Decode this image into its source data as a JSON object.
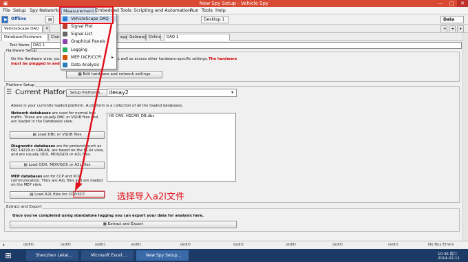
{
  "window": {
    "title": "New Spy Setup - Vehicle Spy"
  },
  "menu": [
    "File",
    "Setup",
    "Spy Networks",
    "Measurement",
    "Embedded Tools",
    "Scripting and Automation",
    "Run",
    "Tools",
    "Help"
  ],
  "toolbar": {
    "mode": "Offline",
    "desktop": "Desktop 1",
    "data": "Data"
  },
  "tabs_row1": [
    "VehicleScape DAQ"
  ],
  "tabs_row2": [
    "Database/Hardware Setup",
    "Chann",
    "ogging",
    "Gateway",
    "Online",
    "DAQ 1"
  ],
  "test_name": {
    "label": "Test Name",
    "value": "DAQ 1"
  },
  "hardware_setup": {
    "label": "Hardware Setup",
    "text_prefix": "On the Hardware view, you",
    "text_suffix": "s well as access other hardware-specific settings.",
    "warning1": "The hardware",
    "warning2": "must be plugged in and p",
    "edit_button": "Edit hardware and network settings"
  },
  "platform_setup": {
    "label": "Platform Setup",
    "title": "Current Platform",
    "setup_button": "Setup Platforms...",
    "platform_value": "desay2",
    "desc": "Above is your currently loaded platform. A platform is a collection of all the loaded databases."
  },
  "network_db": {
    "title": "Network databases",
    "text": " are used for normal bus traffic. These are usually DBC or VSDB files and are loaded in the Databases view.",
    "button": "Load DBC or VSDB files",
    "list": [
      "HS CAN: HSCAN_DB.dbc"
    ]
  },
  "diagnostic_db": {
    "title": "Diagnostic databases",
    "text": " are for protocols such as ISO 14229 or GMLAN, are based on the ECUs view, and are usually ODX, MDX/GDX or A2L files.",
    "button": "Load ODX, MDX/GDX or A2L files"
  },
  "mep_db": {
    "title": "MEP databases",
    "text": " are for CCP and XCP communication. They are A2L files and are loaded on the MEP view.",
    "button": "Load A2L files for CCP/XCP"
  },
  "annotation": "选择导入a2l文件",
  "extract": {
    "label": "Extract and Export",
    "text": "Once you've completed using standalone logging you can export your data for analysis here.",
    "button": "Extract and Export"
  },
  "dropdown": [
    {
      "label": "VehicleScape DAQ",
      "icon": "daq-icon",
      "color": "#2c7fd6"
    },
    {
      "label": "Signal Plot",
      "icon": "plot-icon",
      "color": "#c0392b"
    },
    {
      "label": "Signal List",
      "icon": "list-icon",
      "color": "#666666"
    },
    {
      "label": "Graphical Panels",
      "icon": "panel-icon",
      "color": "#8e44ad"
    },
    {
      "label": "Logging",
      "icon": "logging-icon",
      "color": "#27ae60"
    },
    {
      "label": "MEP (XCP/CCP)",
      "icon": "mep-icon",
      "color": "#d35400"
    },
    {
      "label": "Data Analysis",
      "icon": "analysis-icon",
      "color": "#2980b9"
    }
  ],
  "status": {
    "cells": [
      "(edit)",
      "(edit)",
      "(edit)",
      "(edit)",
      "(edit)",
      "(edit)",
      "(edit)",
      "(edit)",
      "(edit)"
    ],
    "bus": "No Bus Errors"
  },
  "taskbar": {
    "tasks": [
      "Shenzhen Lekai...",
      "Microsoft Excel ...",
      "New Spy Setup..."
    ],
    "time": "10:36 周二",
    "date": "2014-02-11"
  },
  "colors": {
    "titlebar": "#d94a34",
    "highlight": "#e0101a",
    "taskbar": "#1b3a66",
    "warning": "#cc0000"
  }
}
